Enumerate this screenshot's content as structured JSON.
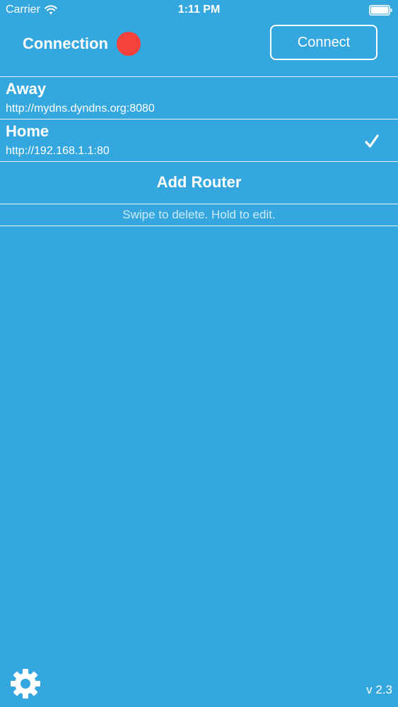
{
  "status_bar": {
    "carrier": "Carrier",
    "time": "1:11 PM",
    "wifi_icon": "wifi-icon",
    "battery_icon": "battery-icon"
  },
  "header": {
    "connection_label": "Connection",
    "status_color": "#f5423c",
    "connect_label": "Connect"
  },
  "routers": [
    {
      "name": "Away",
      "url": "http://mydns.dyndns.org:8080",
      "selected": false
    },
    {
      "name": "Home",
      "url": "http://192.168.1.1:80",
      "selected": true
    }
  ],
  "add_router_label": "Add Router",
  "hint": "Swipe to delete. Hold to edit.",
  "footer": {
    "settings_icon": "gear-icon",
    "version": "v 2.3"
  },
  "colors": {
    "background": "#35a7df",
    "text": "#ffffff"
  }
}
